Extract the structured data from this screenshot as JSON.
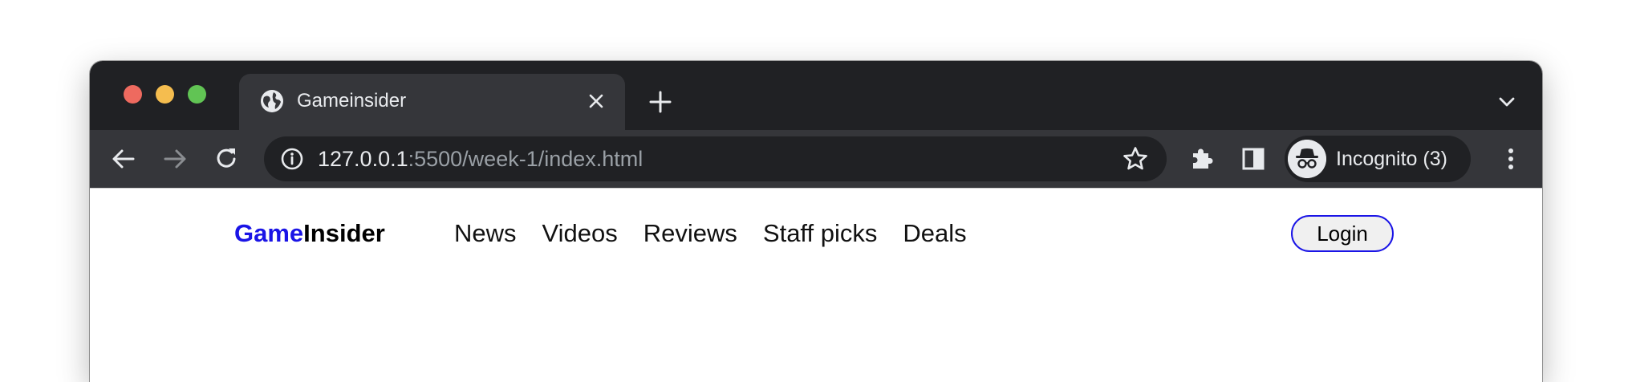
{
  "browser": {
    "tab": {
      "title": "Gameinsider",
      "favicon": "globe-icon"
    },
    "address_bar": {
      "host": "127.0.0.1",
      "path": ":5500/week-1/index.html"
    },
    "profile": {
      "label": "Incognito (3)",
      "icon": "incognito-icon"
    },
    "icons": [
      "back-icon",
      "forward-icon",
      "reload-icon",
      "info-icon",
      "star-icon",
      "extensions-icon",
      "side-panel-icon",
      "menu-icon",
      "close-icon",
      "plus-icon",
      "chevron-down-icon"
    ]
  },
  "page": {
    "logo": {
      "part1": "Game",
      "part2": "Insider"
    },
    "nav": [
      {
        "label": "News"
      },
      {
        "label": "Videos"
      },
      {
        "label": "Reviews"
      },
      {
        "label": "Staff picks"
      },
      {
        "label": "Deals"
      }
    ],
    "login_label": "Login"
  },
  "colors": {
    "accent": "#1a14e6",
    "titlebar": "#202124",
    "toolbar": "#35363a"
  }
}
